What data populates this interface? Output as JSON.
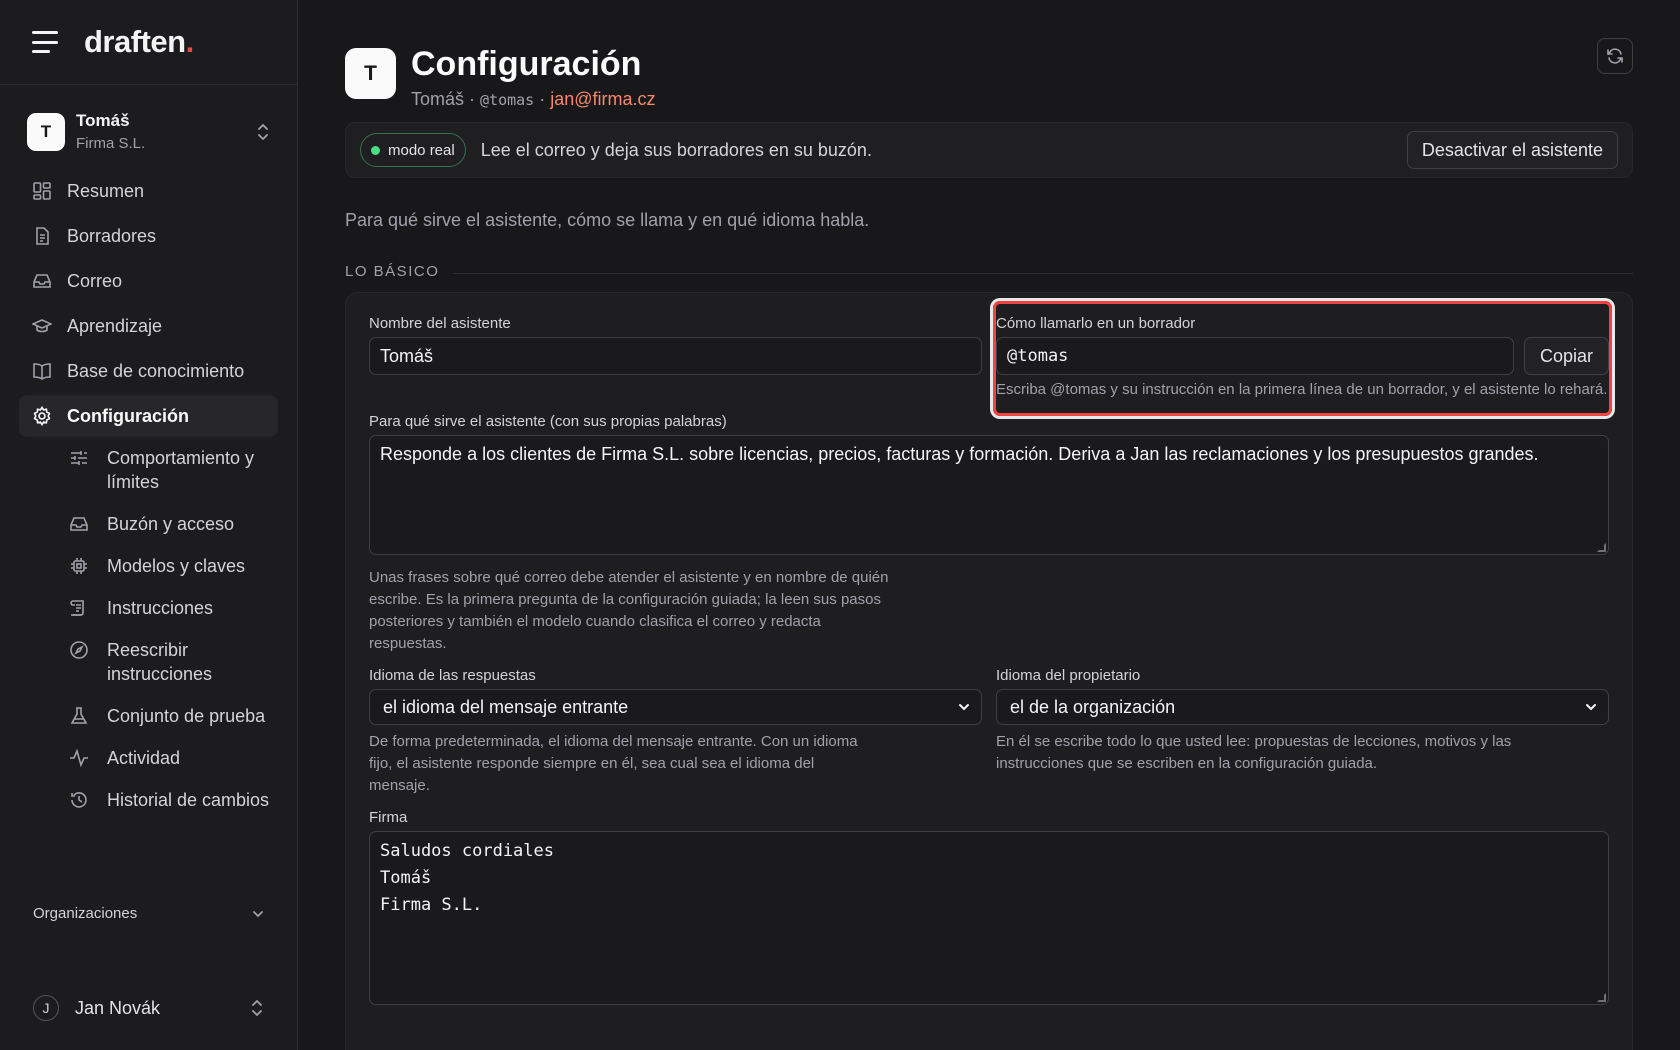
{
  "app": {
    "logo_text": "draften",
    "logo_dot": ".",
    "accent": "#ef4444"
  },
  "workspace": {
    "initial": "T",
    "name": "Tomáš",
    "org": "Firma S.L."
  },
  "nav": {
    "items": [
      {
        "label": "Resumen",
        "icon": "grid-icon"
      },
      {
        "label": "Borradores",
        "icon": "document-icon"
      },
      {
        "label": "Correo",
        "icon": "inbox-icon"
      },
      {
        "label": "Aprendizaje",
        "icon": "graduation-cap-icon"
      },
      {
        "label": "Base de conocimiento",
        "icon": "book-icon"
      },
      {
        "label": "Configuración",
        "icon": "gear-icon",
        "active": true
      }
    ],
    "sub_items": [
      {
        "label": "Comportamiento y límites",
        "icon": "sliders-icon"
      },
      {
        "label": "Buzón y acceso",
        "icon": "inbox-icon"
      },
      {
        "label": "Modelos y claves",
        "icon": "chip-icon"
      },
      {
        "label": "Instrucciones",
        "icon": "scroll-icon"
      },
      {
        "label": "Reescribir instrucciones",
        "icon": "compass-icon"
      },
      {
        "label": "Conjunto de prueba",
        "icon": "flask-icon"
      },
      {
        "label": "Actividad",
        "icon": "activity-icon"
      },
      {
        "label": "Historial de cambios",
        "icon": "history-icon"
      }
    ],
    "orgs_label": "Organizaciones"
  },
  "user": {
    "initial": "J",
    "name": "Jan Novák"
  },
  "header": {
    "initial": "T",
    "title": "Configuración",
    "name": "Tomáš",
    "sep": " · ",
    "handle": "@tomas",
    "email": "jan@firma.cz"
  },
  "banner": {
    "mode": "modo real",
    "text": "Lee el correo y deja sus borradores en su buzón.",
    "deactivate": "Desactivar el asistente"
  },
  "intro": "Para qué sirve el asistente, cómo se llama y en qué idioma habla.",
  "section_title": "LO BÁSICO",
  "form": {
    "name_label": "Nombre del asistente",
    "name_value": "Tomáš",
    "call_label": "Cómo llamarlo en un borrador",
    "call_value": "@tomas",
    "copy_label": "Copiar",
    "call_hint": "Escriba @tomas y su instrucción en la primera línea de un borrador, y el asistente lo rehará.",
    "purpose_label": "Para qué sirve el asistente (con sus propias palabras)",
    "purpose_value": "Responde a los clientes de Firma S.L. sobre licencias, precios, facturas y formación. Deriva a Jan las reclamaciones y los presupuestos grandes.",
    "purpose_hint": "Unas frases sobre qué correo debe atender el asistente y en nombre de quién escribe. Es la primera pregunta de la configuración guiada; la leen sus pasos posteriores y también el modelo cuando clasifica el correo y redacta respuestas.",
    "reply_lang_label": "Idioma de las respuestas",
    "reply_lang_value": "el idioma del mensaje entrante",
    "reply_lang_hint": "De forma predeterminada, el idioma del mensaje entrante. Con un idioma fijo, el asistente responde siempre en él, sea cual sea el idioma del mensaje.",
    "owner_lang_label": "Idioma del propietario",
    "owner_lang_value": "el de la organización",
    "owner_lang_hint": "En él se escribe todo lo que usted lee: propuestas de lecciones, motivos y las instrucciones que se escriben en la configuración guiada.",
    "signature_label": "Firma",
    "signature_lines": [
      "Saludos cordiales",
      "Tomáš",
      "Firma S.L."
    ]
  }
}
